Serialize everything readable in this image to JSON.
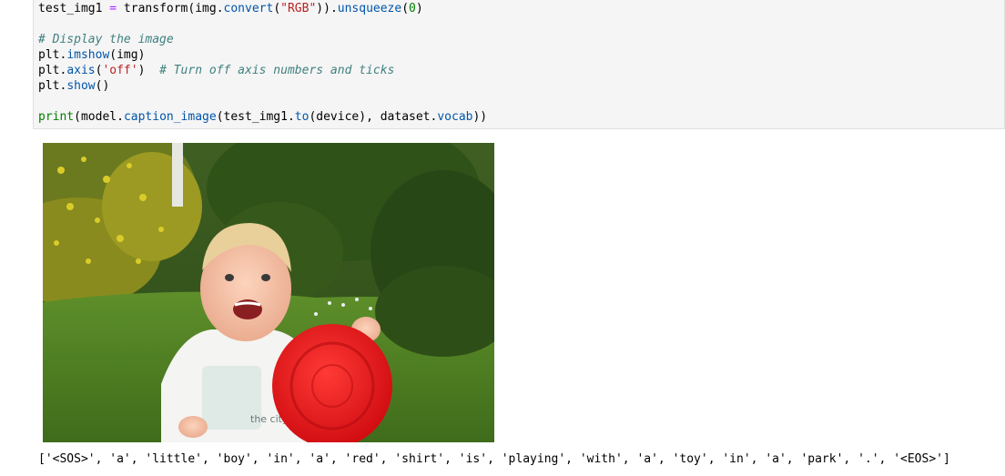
{
  "code_cell": {
    "lines": [
      [
        {
          "text": "test_img1 ",
          "cls": "n"
        },
        {
          "text": "=",
          "cls": "o"
        },
        {
          "text": " transform(img",
          "cls": "n"
        },
        {
          "text": ".",
          "cls": "n"
        },
        {
          "text": "convert",
          "cls": "m"
        },
        {
          "text": "(",
          "cls": "n"
        },
        {
          "text": "\"RGB\"",
          "cls": "s"
        },
        {
          "text": "))",
          "cls": "n"
        },
        {
          "text": ".",
          "cls": "n"
        },
        {
          "text": "unsqueeze",
          "cls": "m"
        },
        {
          "text": "(",
          "cls": "n"
        },
        {
          "text": "0",
          "cls": "d"
        },
        {
          "text": ")",
          "cls": "n"
        }
      ],
      [],
      [
        {
          "text": "# Display the image",
          "cls": "c"
        }
      ],
      [
        {
          "text": "plt",
          "cls": "n"
        },
        {
          "text": ".",
          "cls": "n"
        },
        {
          "text": "imshow",
          "cls": "m"
        },
        {
          "text": "(img)",
          "cls": "n"
        }
      ],
      [
        {
          "text": "plt",
          "cls": "n"
        },
        {
          "text": ".",
          "cls": "n"
        },
        {
          "text": "axis",
          "cls": "m"
        },
        {
          "text": "(",
          "cls": "n"
        },
        {
          "text": "'off'",
          "cls": "s"
        },
        {
          "text": ")  ",
          "cls": "n"
        },
        {
          "text": "# Turn off axis numbers and ticks",
          "cls": "c"
        }
      ],
      [
        {
          "text": "plt",
          "cls": "n"
        },
        {
          "text": ".",
          "cls": "n"
        },
        {
          "text": "show",
          "cls": "m"
        },
        {
          "text": "()",
          "cls": "n"
        }
      ],
      [],
      [
        {
          "text": "print",
          "cls": "b"
        },
        {
          "text": "(model",
          "cls": "n"
        },
        {
          "text": ".",
          "cls": "n"
        },
        {
          "text": "caption_image",
          "cls": "m"
        },
        {
          "text": "(test_img1",
          "cls": "n"
        },
        {
          "text": ".",
          "cls": "n"
        },
        {
          "text": "to",
          "cls": "m"
        },
        {
          "text": "(device), dataset",
          "cls": "n"
        },
        {
          "text": ".",
          "cls": "n"
        },
        {
          "text": "vocab",
          "cls": "m"
        },
        {
          "text": "))",
          "cls": "n"
        }
      ]
    ]
  },
  "output": {
    "caption_text": "['<SOS>', 'a', 'little', 'boy', 'in', 'a', 'red', 'shirt', 'is', 'playing', 'with', 'a', 'toy', 'in', 'a', 'park', '.', '<EOS>']",
    "image_text": "the city"
  },
  "colors": {
    "cell_bg": "#f5f5f5",
    "frisbee": "#e8141b",
    "grass": "#4d7d22",
    "foliage": "#2c4d19"
  }
}
